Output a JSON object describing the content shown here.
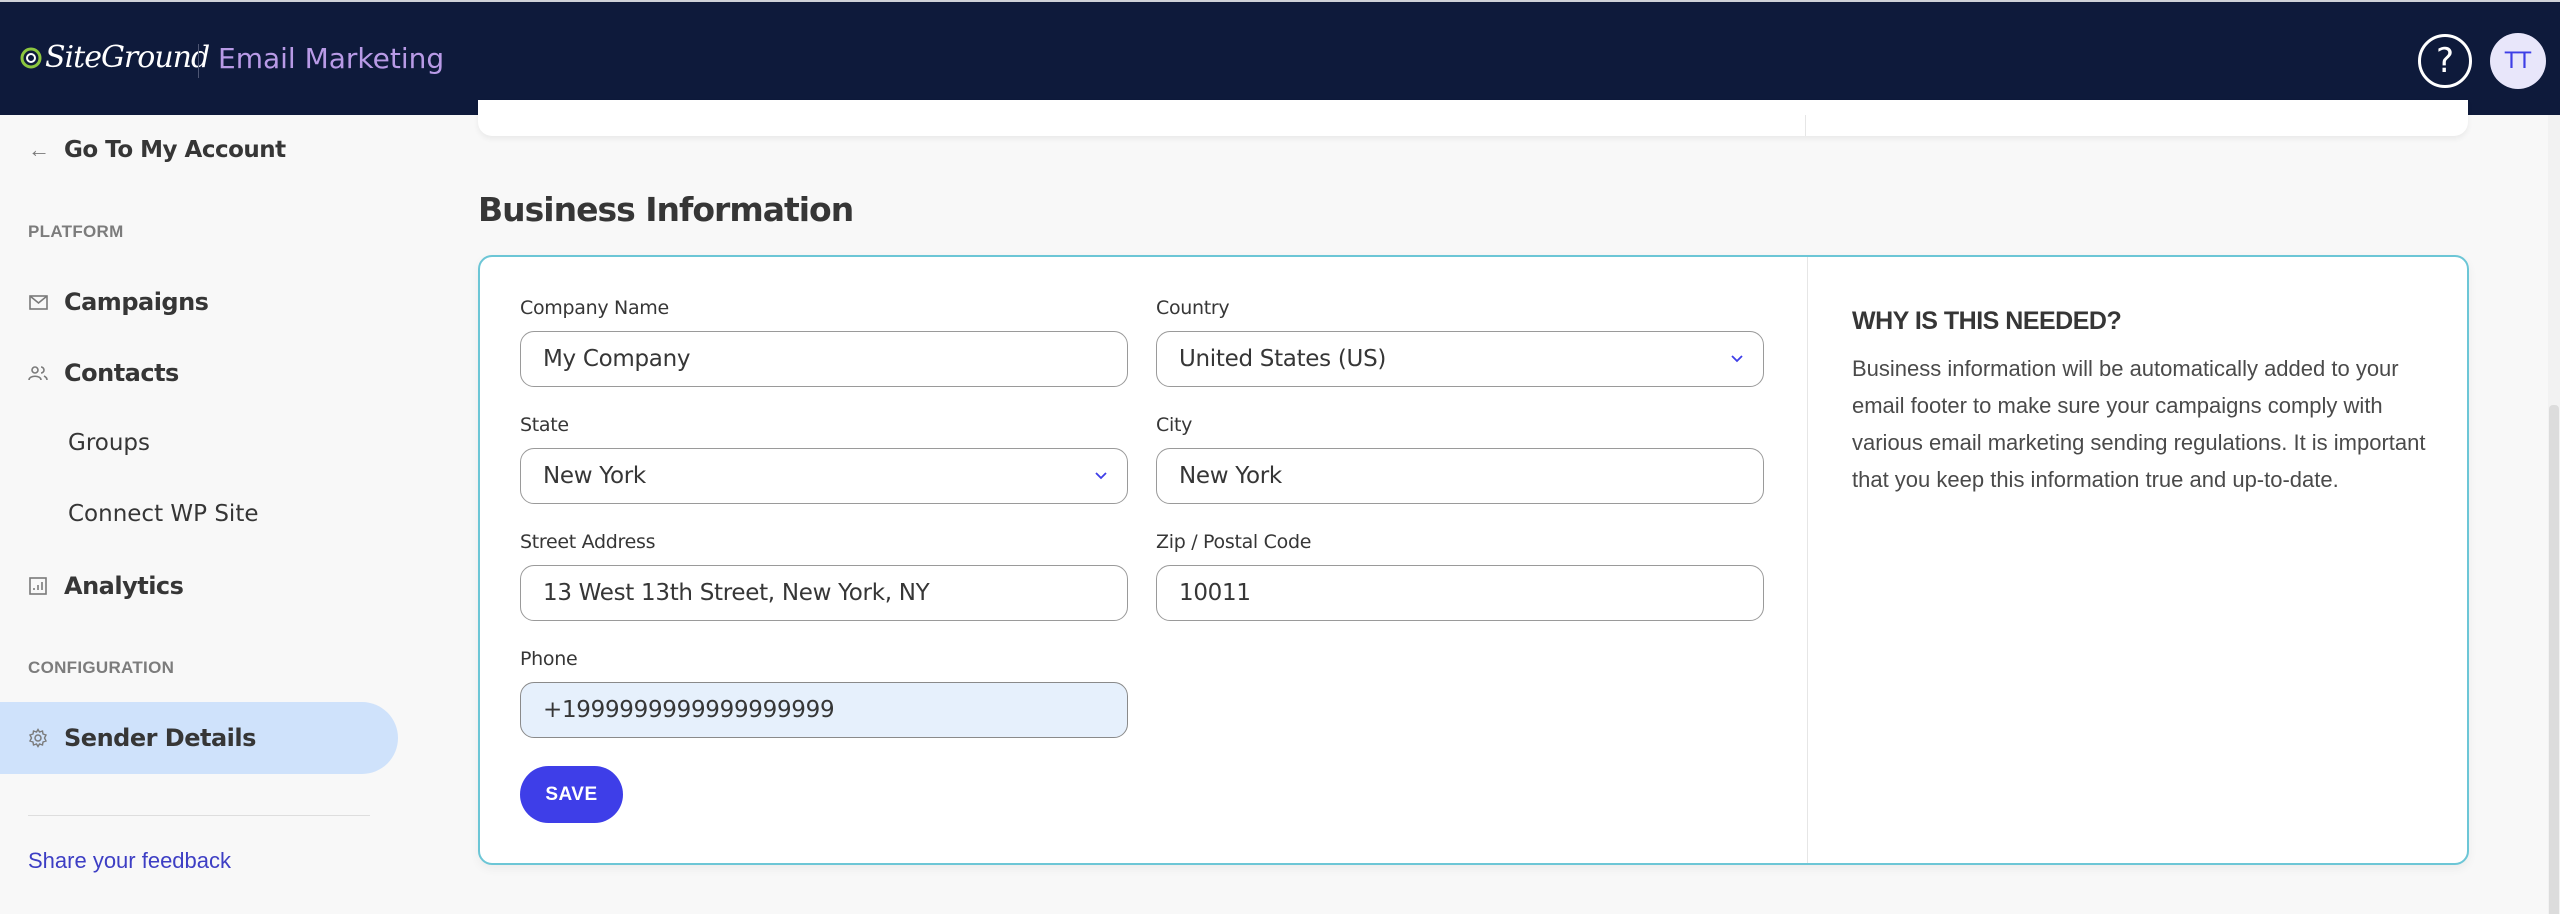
{
  "header": {
    "brand": "SiteGround",
    "app_name": "Email Marketing",
    "help_icon": "?",
    "avatar_initials": "TT"
  },
  "sidebar": {
    "back_link": "Go To My Account",
    "sections": [
      {
        "label": "PLATFORM",
        "items": [
          {
            "label": "Campaigns",
            "icon": "mail-icon"
          },
          {
            "label": "Contacts",
            "icon": "users-icon",
            "children": [
              "Groups",
              "Connect WP Site"
            ]
          },
          {
            "label": "Analytics",
            "icon": "chart-icon"
          }
        ]
      },
      {
        "label": "CONFIGURATION",
        "items": [
          {
            "label": "Sender Details",
            "icon": "gear-icon",
            "active": true
          }
        ]
      }
    ],
    "feedback_link": "Share your feedback"
  },
  "main": {
    "section_title": "Business Information",
    "form": {
      "company_name": {
        "label": "Company Name",
        "value": "My Company"
      },
      "country": {
        "label": "Country",
        "value": "United States (US)"
      },
      "state": {
        "label": "State",
        "value": "New York"
      },
      "city": {
        "label": "City",
        "value": "New York"
      },
      "street": {
        "label": "Street Address",
        "value": "13 West 13th Street, New York, NY"
      },
      "zip": {
        "label": "Zip / Postal Code",
        "value": "10011"
      },
      "phone": {
        "label": "Phone",
        "value": "+1999999999999999999"
      },
      "save_label": "SAVE"
    },
    "info": {
      "title": "WHY IS THIS NEEDED?",
      "text": "Business information will be automatically added to your email footer to make sure your campaigns comply with various email marketing sending regulations. It is important that you keep this information true and up-to-date."
    }
  },
  "colors": {
    "header_bg": "#0e1a3b",
    "accent": "#3e3ee8",
    "app_name": "#b89ae6",
    "active_nav_bg": "#cfe2fb",
    "card_border": "#6cc6d6",
    "filled_input_bg": "#e6f0fc"
  }
}
